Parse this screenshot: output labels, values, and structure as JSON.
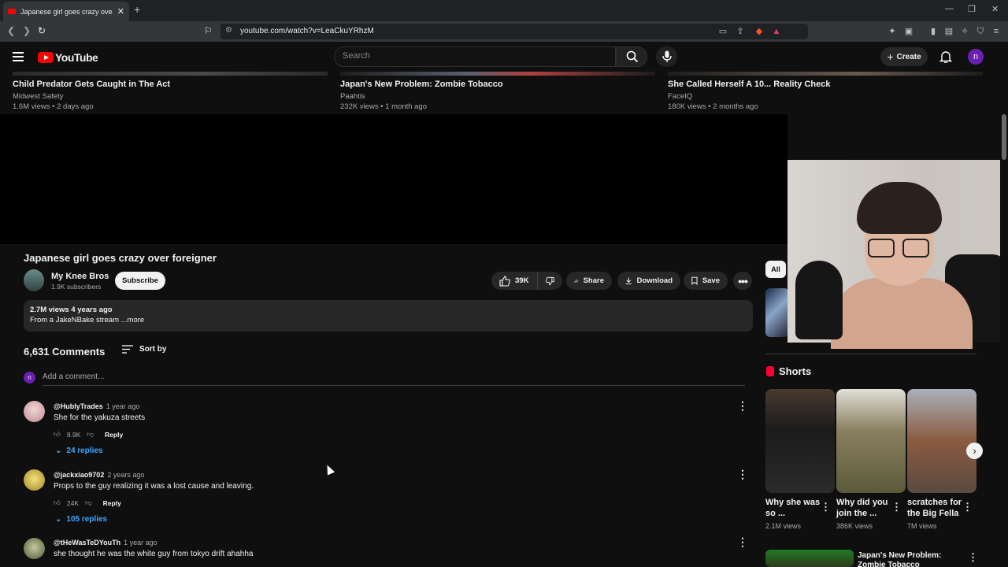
{
  "browser": {
    "tab_title": "Japanese girl goes crazy over foreigner",
    "url": "youtube.com/watch?v=LeaCkuYRhzM"
  },
  "header": {
    "logo_text": "YouTube",
    "search_placeholder": "Search",
    "create_label": "Create",
    "avatar_letter": "n"
  },
  "recommended": [
    {
      "title": "Child Predator Gets Caught in The Act",
      "channel": "Midwest Safety",
      "meta": "1.6M views • 2 days ago"
    },
    {
      "title": "Japan's New Problem: Zombie Tobacco",
      "channel": "Paahtis",
      "meta": "232K views • 1 month ago"
    },
    {
      "title": "She Called Herself A 10... Reality Check",
      "channel": "FaceIQ",
      "meta": "180K views • 2 months ago"
    }
  ],
  "video": {
    "title": "Japanese girl goes crazy over foreigner",
    "channel": "My Knee Bros",
    "subscribers": "1.9K subscribers",
    "subscribe_label": "Subscribe",
    "likes": "39K",
    "share_label": "Share",
    "download_label": "Download",
    "save_label": "Save",
    "description_stats": "2.7M views  4 years ago",
    "description_text": "From a JakeNBake stream ...more"
  },
  "comments": {
    "count": "6,631 Comments",
    "sort_label": "Sort by",
    "add_placeholder": "Add a comment...",
    "my_avatar": "n",
    "items": [
      {
        "user": "@HublyTrades",
        "time": "1 year ago",
        "text": "She for the yakuza streets",
        "likes": "8.9K",
        "reply": "Reply",
        "replies": "24 replies"
      },
      {
        "user": "@jackxiao9702",
        "time": "2 years ago",
        "text": "Props to the guy realizing it was a lost cause and leaving.",
        "likes": "24K",
        "reply": "Reply",
        "replies": "105 replies"
      },
      {
        "user": "@tHeWasTeDYouTh",
        "time": "1 year ago",
        "text": "she thought he was the white guy from tokyo drift ahahha"
      }
    ]
  },
  "sidebar": {
    "chip_all": "All",
    "shorts_title": "Shorts",
    "shorts": [
      {
        "title": "Why she was so ...",
        "views": "2.1M views"
      },
      {
        "title": "Why did you join the ...",
        "views": "386K views"
      },
      {
        "title": "scratches for the Big Fella",
        "views": "7M views"
      }
    ],
    "bottom_title": "Japan's New Problem: Zombie Tobacco"
  },
  "colors": {
    "accent_red": "#ff0000",
    "link_blue": "#3ea6ff",
    "avatar_purple": "#6b1fb1"
  }
}
